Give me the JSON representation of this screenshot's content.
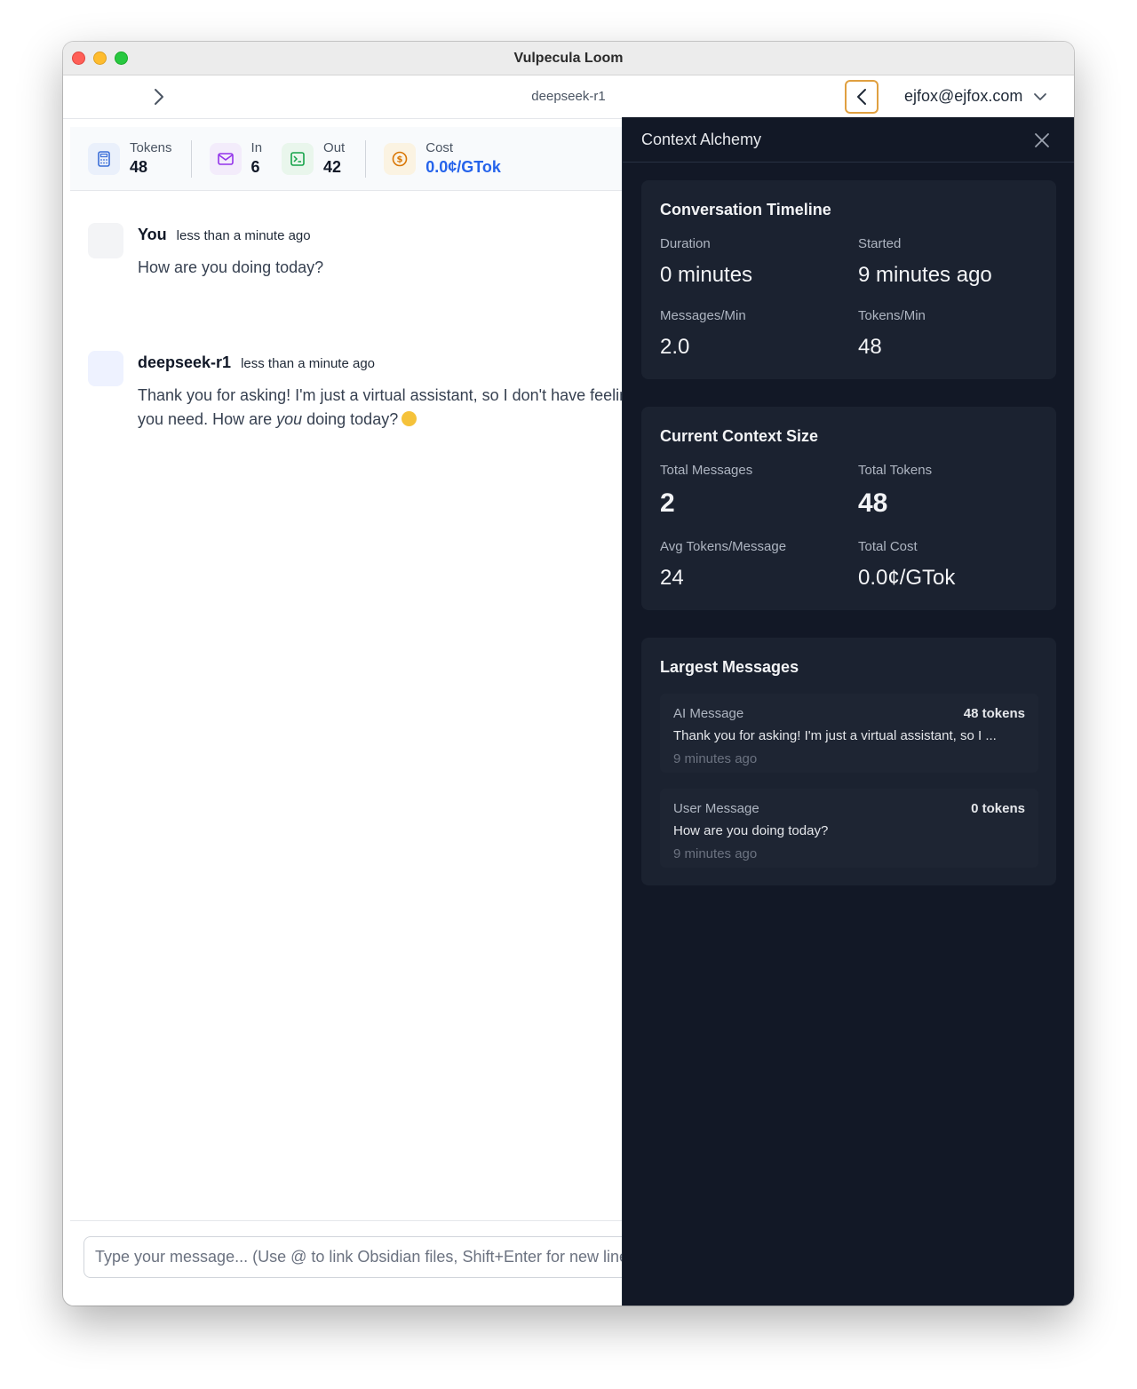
{
  "window": {
    "title": "Vulpecula Loom"
  },
  "topbar": {
    "model": "deepseek-r1",
    "user_email": "ejfox@ejfox.com"
  },
  "stats": {
    "tokens_label": "Tokens",
    "tokens_value": "48",
    "in_label": "In",
    "in_value": "6",
    "out_label": "Out",
    "out_value": "42",
    "cost_label": "Cost",
    "cost_value": "0.0¢/GTok"
  },
  "messages": [
    {
      "author": "You",
      "time": "less than a minute ago",
      "text": "How are you doing today?"
    },
    {
      "author": "deepseek-r1",
      "time": "less than a minute ago",
      "line1": "Thank you for asking! I'm just a virtual assistant, so I don't have feelings, but I'm here and ready to help with anything",
      "line2_pre": "you need. How are ",
      "line2_em": "you",
      "line2_post": " doing today?"
    }
  ],
  "composer": {
    "placeholder": "Type your message... (Use @ to link Obsidian files, Shift+Enter for new line)"
  },
  "panel": {
    "title": "Context Alchemy",
    "timeline": {
      "title": "Conversation Timeline",
      "duration_label": "Duration",
      "duration_value": "0 minutes",
      "started_label": "Started",
      "started_value": "9 minutes ago",
      "mpm_label": "Messages/Min",
      "mpm_value": "2.0",
      "tpm_label": "Tokens/Min",
      "tpm_value": "48"
    },
    "context": {
      "title": "Current Context Size",
      "total_messages_label": "Total Messages",
      "total_messages_value": "2",
      "total_tokens_label": "Total Tokens",
      "total_tokens_value": "48",
      "avg_label": "Avg Tokens/Message",
      "avg_value": "24",
      "cost_label": "Total Cost",
      "cost_value": "0.0¢/GTok"
    },
    "largest": {
      "title": "Largest Messages",
      "items": [
        {
          "type": "AI Message",
          "tokens": "48 tokens",
          "preview": "Thank you for asking! I'm just a virtual assistant, so I ...",
          "time": "9 minutes ago"
        },
        {
          "type": "User Message",
          "tokens": "0 tokens",
          "preview": "How are you doing today?",
          "time": "9 minutes ago"
        }
      ]
    }
  },
  "icons": {
    "expand_sidebar": "chevron-right-icon",
    "toggle_panel": "chevron-left-icon",
    "user_menu": "chevron-down-icon",
    "tokens": "calculator-icon",
    "in": "envelope-icon",
    "out": "terminal-icon",
    "cost": "coin-icon",
    "close": "close-icon"
  },
  "colors": {
    "accent_blue": "#2563eb",
    "panel_bg": "#121826",
    "card_bg": "#1b2230",
    "toggle_border": "#e0a040"
  }
}
